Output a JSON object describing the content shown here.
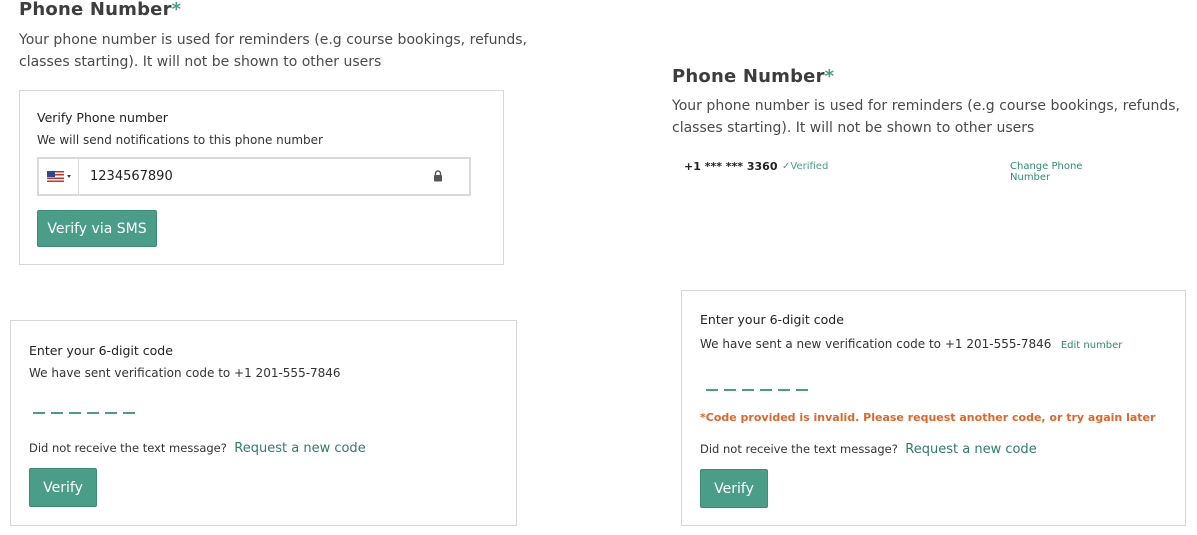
{
  "left_section": {
    "heading": "Phone Number",
    "required_marker": "*",
    "description": "Your phone number is used for reminders (e.g course bookings, refunds, classes starting). It will not be shown to other users"
  },
  "verify_card": {
    "title": "Verify Phone number",
    "subtitle": "We will send notifications to this phone number",
    "country_flag": "us-flag-icon",
    "phone_value": "1234567890",
    "lock_icon": "lock-icon",
    "button_label": "Verify via SMS"
  },
  "code_card_left": {
    "title": "Enter your 6-digit code",
    "subtitle": "We have sent verification code to +1 201-555-7846",
    "code_length": 6,
    "help_text": "Did not receive the text message?",
    "resend_link": "Request a new code",
    "button_label": "Verify"
  },
  "right_section": {
    "heading": "Phone Number",
    "required_marker": "*",
    "description": "Your phone number is used for reminders (e.g course bookings, refunds, classes starting). It will not be shown to other users",
    "masked_number": "+1 *** *** 3360",
    "verified_check": "✓",
    "verified_label": "Verified",
    "change_link": "Change Phone Number"
  },
  "code_card_right": {
    "title": "Enter your 6-digit code",
    "subtitle": "We have sent a new verification code to +1 201-555-7846",
    "edit_link": "Edit number",
    "code_length": 6,
    "error": "*Code provided is invalid. Please request another code, or try again later",
    "help_text": "Did not receive the text message?",
    "resend_link": "Request a new code",
    "button_label": "Verify"
  },
  "colors": {
    "accent": "#4a9d86",
    "link": "#2e7d68",
    "error": "#e0662a",
    "border": "#d7d7d7"
  }
}
